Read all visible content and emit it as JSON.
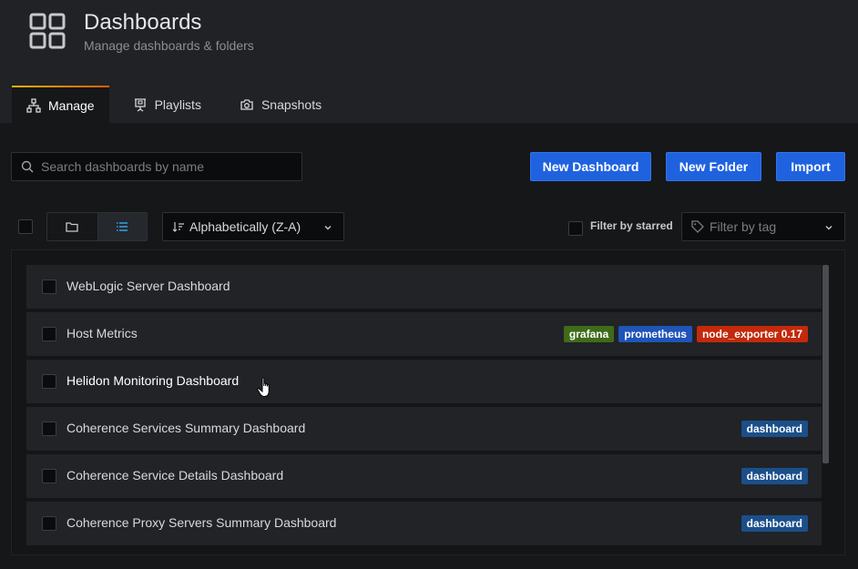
{
  "header": {
    "icon": "dashboards-grid-icon",
    "title": "Dashboards",
    "subtitle": "Manage dashboards & folders"
  },
  "tabs": [
    {
      "label": "Manage",
      "icon": "sitemap-icon",
      "active": true
    },
    {
      "label": "Playlists",
      "icon": "presentation-icon",
      "active": false
    },
    {
      "label": "Snapshots",
      "icon": "camera-icon",
      "active": false
    }
  ],
  "toolbar": {
    "search_placeholder": "Search dashboards by name",
    "new_dashboard_label": "New Dashboard",
    "new_folder_label": "New Folder",
    "import_label": "Import",
    "sort_label": "Alphabetically (Z-A)",
    "filter_starred_label": "Filter by starred",
    "filter_tag_placeholder": "Filter by tag",
    "view_mode": "list"
  },
  "dashboards": [
    {
      "title": "WebLogic Server Dashboard",
      "tags": []
    },
    {
      "title": "Host Metrics",
      "tags": [
        {
          "label": "grafana",
          "color": "#3f6b1a"
        },
        {
          "label": "prometheus",
          "color": "#1f54b8"
        },
        {
          "label": "node_exporter 0.17",
          "color": "#c4290b"
        }
      ]
    },
    {
      "title": "Helidon Monitoring Dashboard",
      "tags": [],
      "hovered": true
    },
    {
      "title": "Coherence Services Summary Dashboard",
      "tags": [
        {
          "label": "dashboard",
          "color": "#1b4f8a"
        }
      ]
    },
    {
      "title": "Coherence Service Details Dashboard",
      "tags": [
        {
          "label": "dashboard",
          "color": "#1b4f8a"
        }
      ]
    },
    {
      "title": "Coherence Proxy Servers Summary Dashboard",
      "tags": [
        {
          "label": "dashboard",
          "color": "#1b4f8a"
        }
      ]
    }
  ],
  "colors": {
    "primary_button": "#1f62e0",
    "tab_accent": "#f7b500"
  }
}
